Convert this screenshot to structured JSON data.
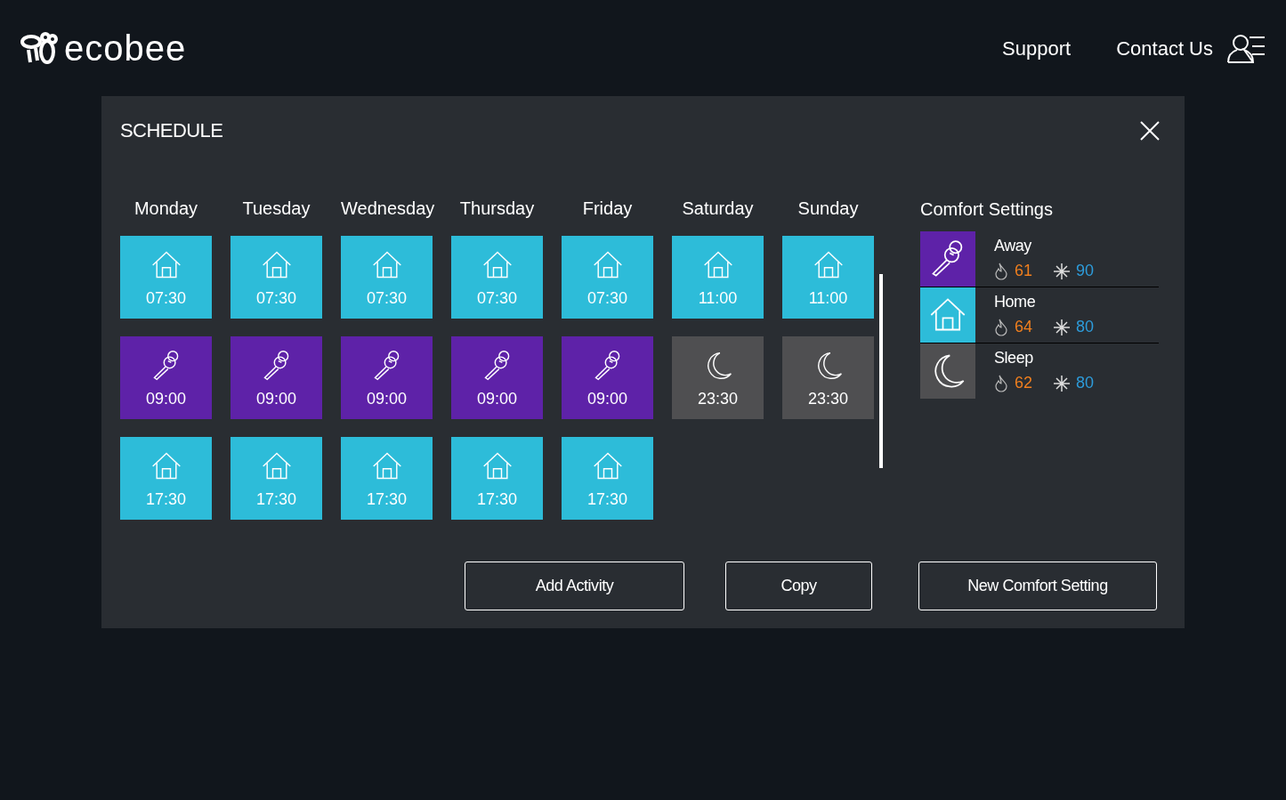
{
  "header": {
    "logo": "ecobee",
    "nav": [
      "Support",
      "Contact Us"
    ]
  },
  "schedule": {
    "title": "SCHEDULE",
    "days": [
      {
        "name": "Monday",
        "activities": [
          {
            "kind": "home",
            "time": "07:30"
          },
          {
            "kind": "away",
            "time": "09:00"
          },
          {
            "kind": "home",
            "time": "17:30"
          }
        ]
      },
      {
        "name": "Tuesday",
        "activities": [
          {
            "kind": "home",
            "time": "07:30"
          },
          {
            "kind": "away",
            "time": "09:00"
          },
          {
            "kind": "home",
            "time": "17:30"
          }
        ]
      },
      {
        "name": "Wednesday",
        "activities": [
          {
            "kind": "home",
            "time": "07:30"
          },
          {
            "kind": "away",
            "time": "09:00"
          },
          {
            "kind": "home",
            "time": "17:30"
          }
        ]
      },
      {
        "name": "Thursday",
        "activities": [
          {
            "kind": "home",
            "time": "07:30"
          },
          {
            "kind": "away",
            "time": "09:00"
          },
          {
            "kind": "home",
            "time": "17:30"
          }
        ]
      },
      {
        "name": "Friday",
        "activities": [
          {
            "kind": "home",
            "time": "07:30"
          },
          {
            "kind": "away",
            "time": "09:00"
          },
          {
            "kind": "home",
            "time": "17:30"
          }
        ]
      },
      {
        "name": "Saturday",
        "activities": [
          {
            "kind": "home",
            "time": "11:00"
          },
          {
            "kind": "sleep",
            "time": "23:30"
          }
        ]
      },
      {
        "name": "Sunday",
        "activities": [
          {
            "kind": "home",
            "time": "11:00"
          },
          {
            "kind": "sleep",
            "time": "23:30"
          }
        ]
      }
    ],
    "comfort_settings": {
      "title": "Comfort Settings",
      "items": [
        {
          "kind": "away",
          "name": "Away",
          "heat": "61",
          "cool": "90"
        },
        {
          "kind": "home",
          "name": "Home",
          "heat": "64",
          "cool": "80"
        },
        {
          "kind": "sleep",
          "name": "Sleep",
          "heat": "62",
          "cool": "80"
        }
      ]
    },
    "buttons": [
      "Add Activity",
      "Copy",
      "New Comfort Setting"
    ]
  }
}
